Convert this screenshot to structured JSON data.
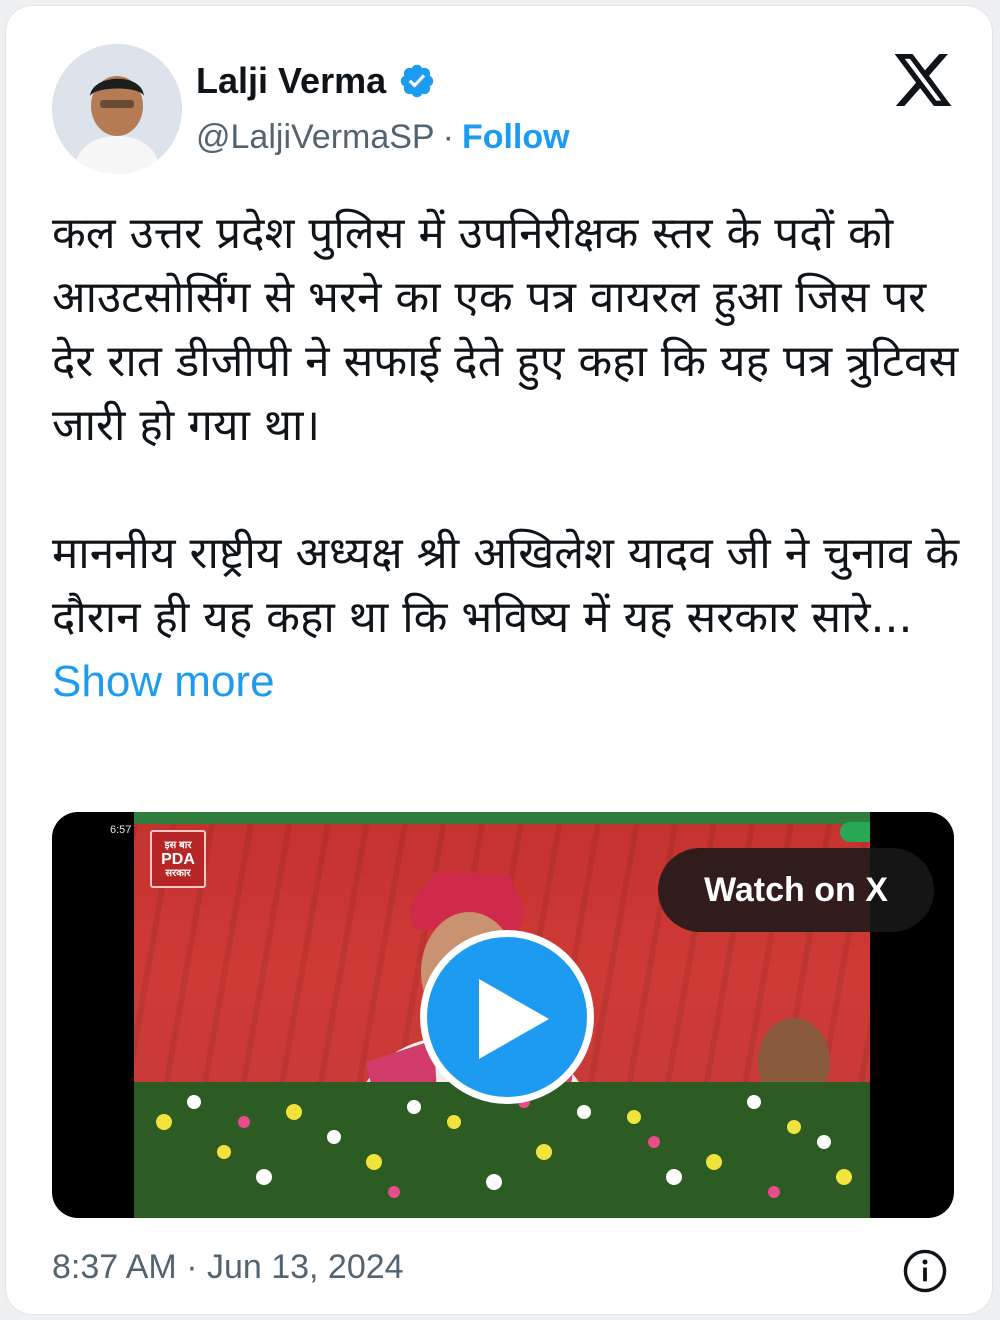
{
  "author": {
    "name": "Lalji Verma",
    "handle": "@LaljiVermaSP",
    "separator": "·",
    "follow_label": "Follow",
    "verified": true
  },
  "tweet": {
    "text": "कल उत्तर प्रदेश पुलिस में उपनिरीक्षक स्तर के पदों को आउटसोर्सिंग से भरने का एक पत्र वायरल हुआ जिस पर देर रात डीजीपी ने सफाई देते हुए कहा कि यह पत्र त्रुटिवस जारी हो गया था।\n\nमाननीय राष्ट्रीय अध्यक्ष श्री अखिलेश यादव जी ने चुनाव के दौरान ही यह कहा था कि भविष्य में यह सरकार सारे... ",
    "show_more_label": "Show more"
  },
  "media": {
    "watch_label": "Watch on X",
    "overlay_time": "6:57",
    "logo_line1": "इस बार",
    "logo_line2": "PDA",
    "logo_line3": "सरकार"
  },
  "footer": {
    "timestamp": "8:37 AM · Jun 13, 2024"
  },
  "colors": {
    "accent": "#1d9bf0",
    "text": "#0f1419",
    "muted": "#536471"
  },
  "icons": [
    "verified-badge-icon",
    "x-logo-icon",
    "play-icon",
    "info-icon"
  ]
}
